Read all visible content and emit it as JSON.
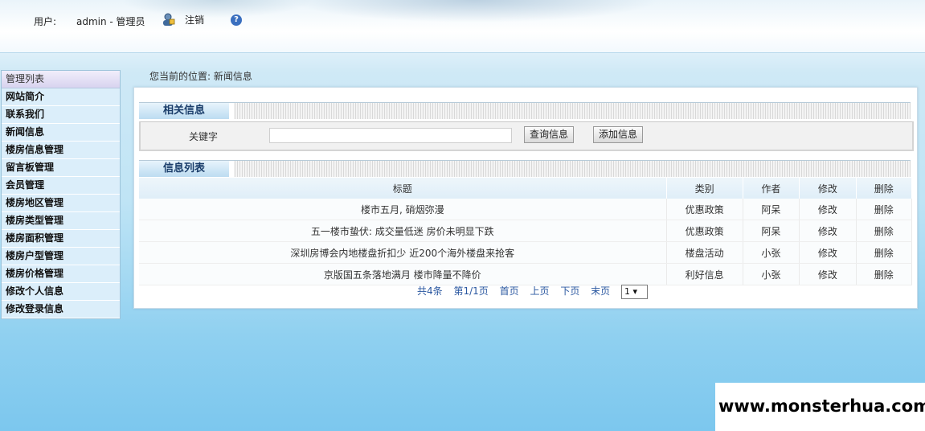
{
  "header": {
    "user_label": "用户:",
    "user_name": "admin - 管理员",
    "logout_label": "注销",
    "help_glyph": "?"
  },
  "sidebar": {
    "title": "管理列表",
    "items": [
      {
        "label": "网站简介"
      },
      {
        "label": "联系我们"
      },
      {
        "label": "新闻信息"
      },
      {
        "label": "楼房信息管理"
      },
      {
        "label": "留言板管理"
      },
      {
        "label": "会员管理"
      },
      {
        "label": "楼房地区管理"
      },
      {
        "label": "楼房类型管理"
      },
      {
        "label": "楼房面积管理"
      },
      {
        "label": "楼房户型管理"
      },
      {
        "label": "楼房价格管理"
      },
      {
        "label": "修改个人信息"
      },
      {
        "label": "修改登录信息"
      }
    ]
  },
  "breadcrumb": "您当前的位置: 新闻信息",
  "search": {
    "section_title": "相关信息",
    "keyword_label": "关键字",
    "keyword_value": "",
    "query_button": "查询信息",
    "add_button": "添加信息"
  },
  "list": {
    "section_title": "信息列表",
    "columns": [
      "标题",
      "类别",
      "作者",
      "修改",
      "删除"
    ],
    "rows": [
      {
        "title": "楼市五月, 硝烟弥漫",
        "category": "优惠政策",
        "author": "阿呆",
        "edit": "修改",
        "delete": "删除"
      },
      {
        "title": "五一楼市蛰伏: 成交量低迷 房价未明显下跌",
        "category": "优惠政策",
        "author": "阿呆",
        "edit": "修改",
        "delete": "删除"
      },
      {
        "title": "深圳房博会内地楼盘折扣少 近200个海外楼盘来抢客",
        "category": "楼盘活动",
        "author": "小张",
        "edit": "修改",
        "delete": "删除"
      },
      {
        "title": "京版国五条落地满月 楼市降量不降价",
        "category": "利好信息",
        "author": "小张",
        "edit": "修改",
        "delete": "删除"
      }
    ]
  },
  "pager": {
    "total": "共4条",
    "page_info": "第1/1页",
    "first": "首页",
    "prev": "上页",
    "next": "下页",
    "last": "末页",
    "current_page": "1 ▾"
  },
  "watermark": "www.monsterhua.com"
}
